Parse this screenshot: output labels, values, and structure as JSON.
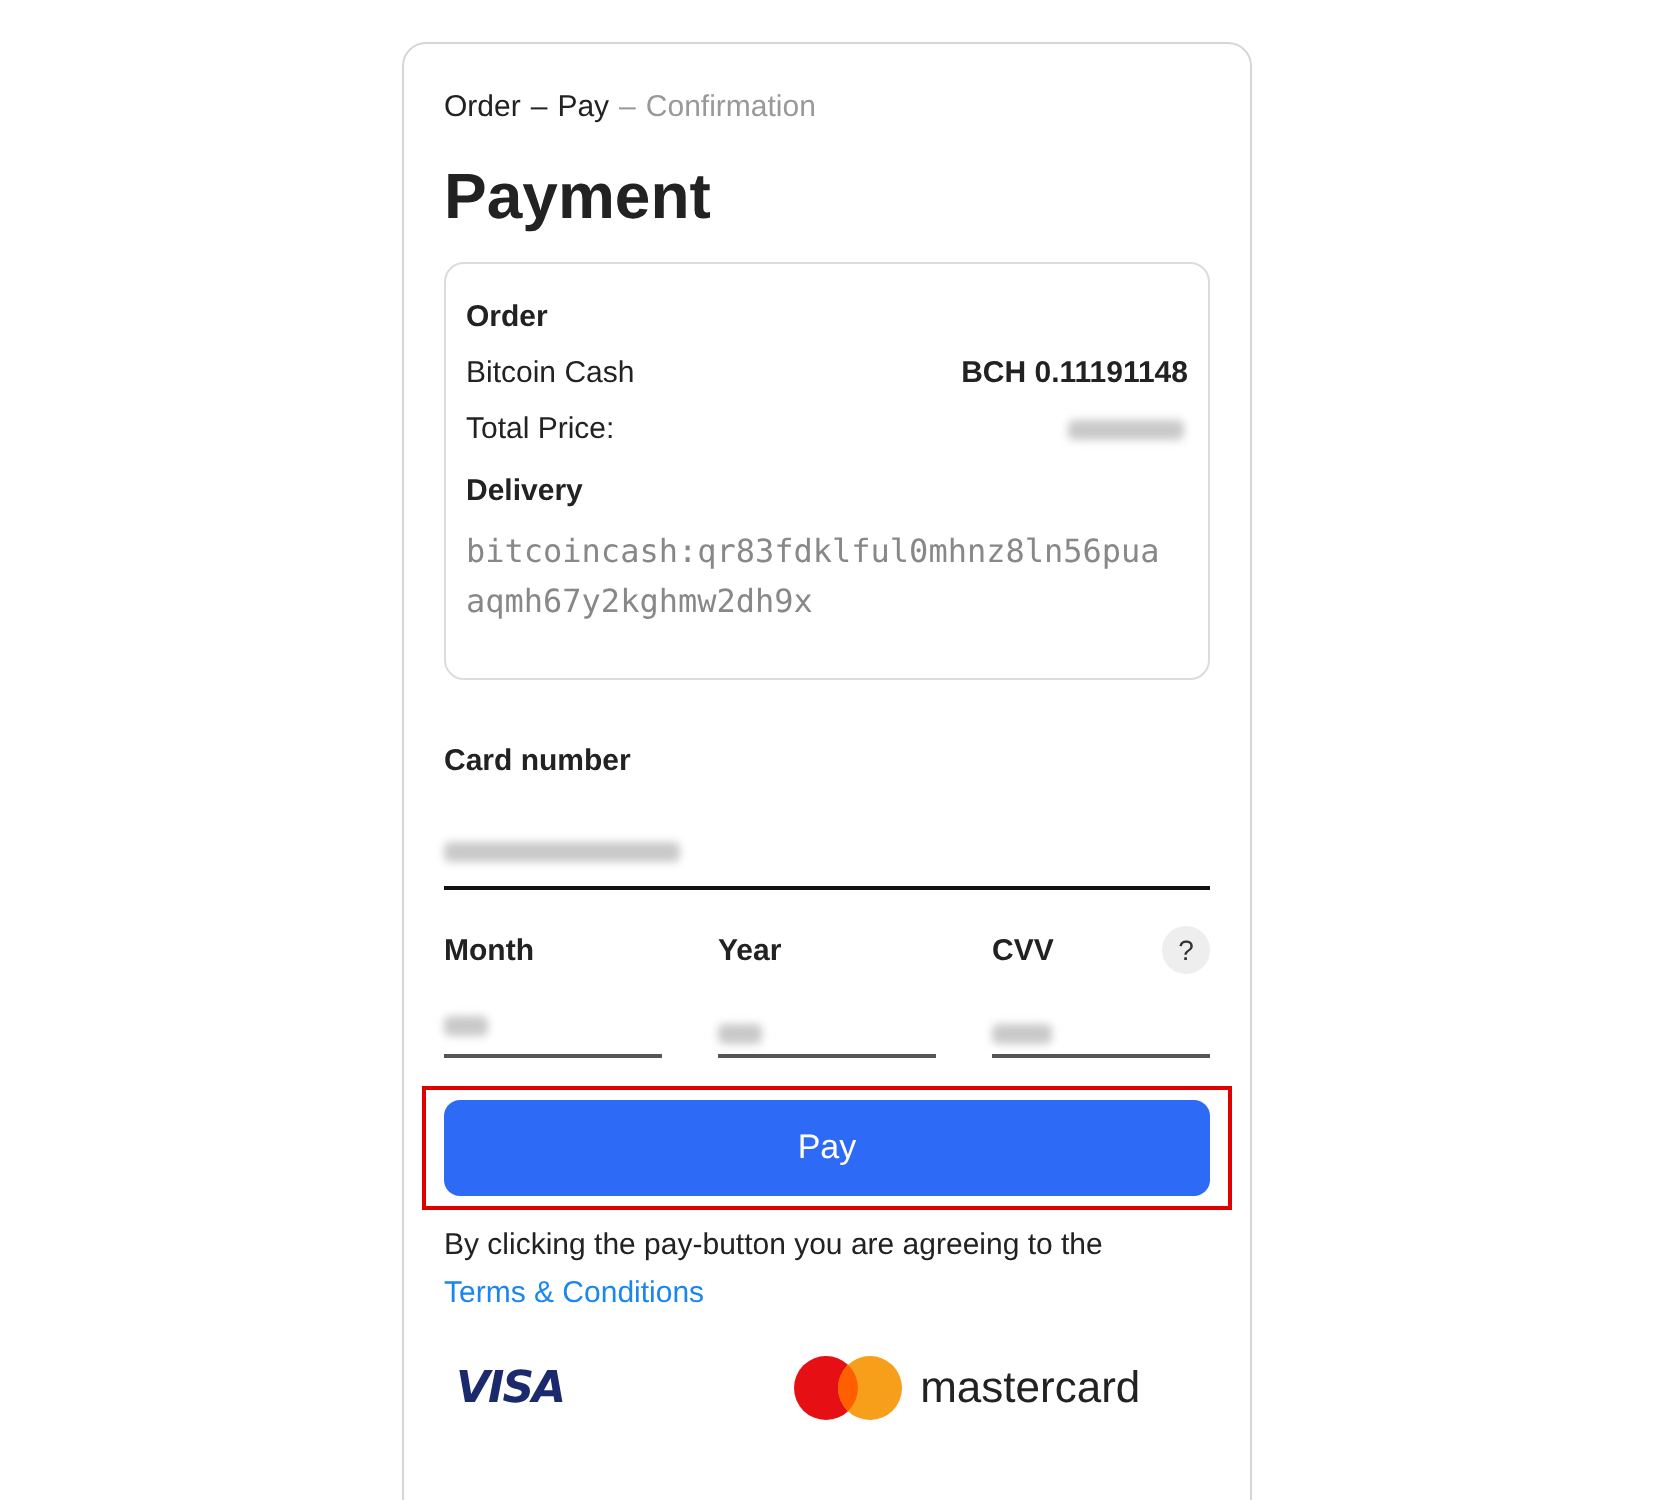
{
  "breadcrumb": [
    {
      "label": "Order",
      "reached": true
    },
    {
      "label": "–",
      "reached": true
    },
    {
      "label": "Pay",
      "reached": true
    },
    {
      "label": "–",
      "reached": false
    },
    {
      "label": "Confirmation",
      "reached": false
    }
  ],
  "title": "Payment",
  "order": {
    "heading": "Order",
    "item": "Bitcoin Cash",
    "amount": "BCH 0.11191148",
    "total_label": "Total Price:",
    "delivery_heading": "Delivery",
    "address": "bitcoincash:qr83fdklful0mhnz8ln56puaaqmh67y2kghmw2dh9x"
  },
  "card_field": {
    "label": "Card number",
    "focused": true
  },
  "fields": [
    {
      "label": "Month",
      "help": false
    },
    {
      "label": "Year",
      "help": false
    },
    {
      "label": "CVV",
      "help": true,
      "help_icon": "?"
    }
  ],
  "pay_button": {
    "label": "Pay",
    "highlighted": true
  },
  "terms": {
    "text": "By clicking the pay-button you are agreeing to the",
    "link": "Terms & Conditions"
  },
  "logos": {
    "visa": "VISA",
    "mastercard": "mastercard"
  }
}
